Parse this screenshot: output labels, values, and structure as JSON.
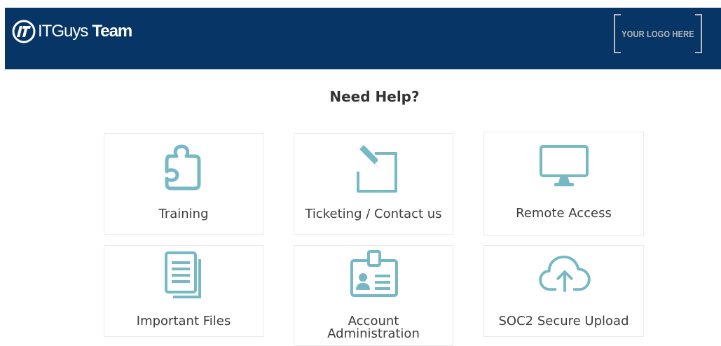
{
  "header": {
    "brand": {
      "name_part1": "ITGuys",
      "name_part2": "Team",
      "logo_icon": "it-circle-logo-icon"
    },
    "logo_placeholder": "YOUR LOGO HERE"
  },
  "main": {
    "title": "Need Help?",
    "tiles": [
      {
        "label": "Training",
        "icon": "puzzle-piece-icon"
      },
      {
        "label": "Ticketing / Contact us",
        "icon": "edit-pencil-icon"
      },
      {
        "label": "Remote Access",
        "icon": "monitor-icon"
      },
      {
        "label": "Important Files",
        "icon": "documents-icon"
      },
      {
        "label": "Account Administration",
        "icon": "id-badge-icon"
      },
      {
        "label": "SOC2 Secure Upload",
        "icon": "cloud-upload-icon"
      }
    ]
  },
  "colors": {
    "header_bg": "#063566",
    "icon_teal": "#76b9c4",
    "text": "#3d3d3d"
  }
}
